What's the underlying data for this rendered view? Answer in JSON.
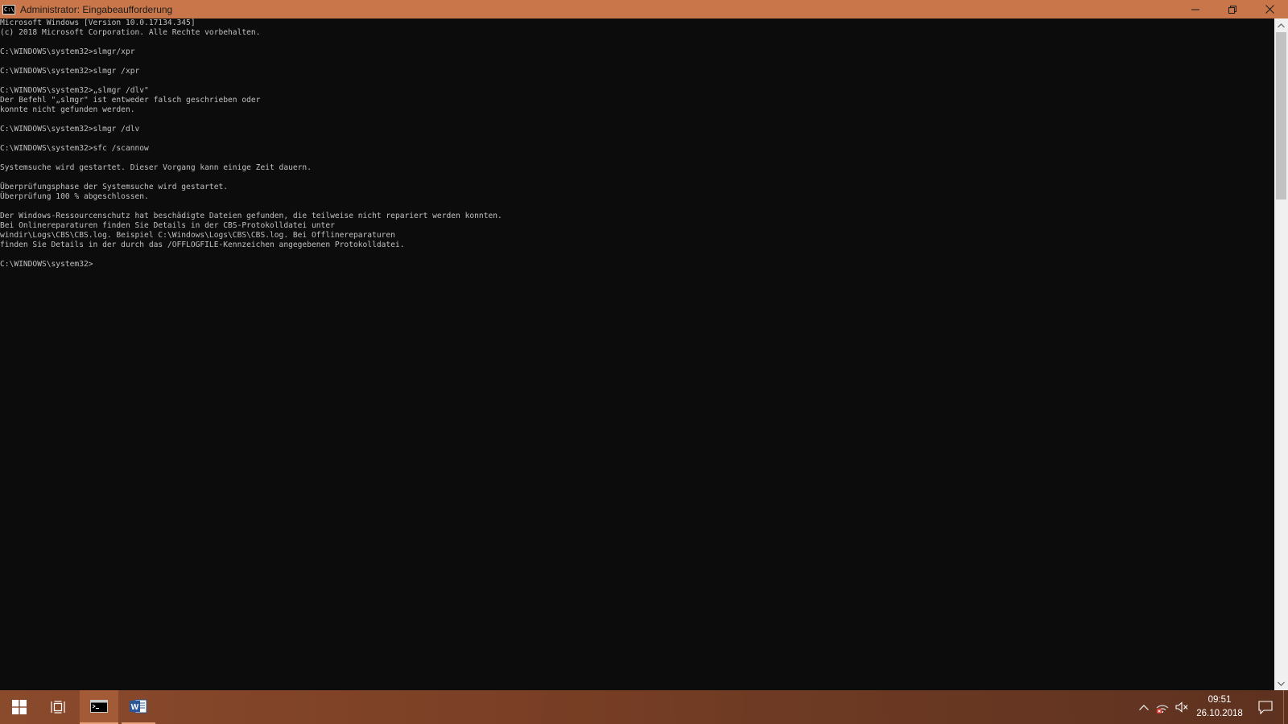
{
  "window": {
    "title": "Administrator: Eingabeaufforderung",
    "icon_text": "C:\\"
  },
  "console": {
    "lines": [
      "Microsoft Windows [Version 10.0.17134.345]",
      "(c) 2018 Microsoft Corporation. Alle Rechte vorbehalten.",
      "",
      "C:\\WINDOWS\\system32>slmgr/xpr",
      "",
      "C:\\WINDOWS\\system32>slmgr /xpr",
      "",
      "C:\\WINDOWS\\system32>„slmgr /dlv\"",
      "Der Befehl \"„slmgr\" ist entweder falsch geschrieben oder",
      "konnte nicht gefunden werden.",
      "",
      "C:\\WINDOWS\\system32>slmgr /dlv",
      "",
      "C:\\WINDOWS\\system32>sfc /scannow",
      "",
      "Systemsuche wird gestartet. Dieser Vorgang kann einige Zeit dauern.",
      "",
      "Überprüfungsphase der Systemsuche wird gestartet.",
      "Überprüfung 100 % abgeschlossen.",
      "",
      "Der Windows-Ressourcenschutz hat beschädigte Dateien gefunden, die teilweise nicht repariert werden konnten.",
      "Bei Onlinereparaturen finden Sie Details in der CBS-Protokolldatei unter",
      "windir\\Logs\\CBS\\CBS.log. Beispiel C:\\Windows\\Logs\\CBS\\CBS.log. Bei Offlinereparaturen",
      "finden Sie Details in der durch das /OFFLOGFILE-Kennzeichen angegebenen Protokolldatei.",
      "",
      "C:\\WINDOWS\\system32>"
    ]
  },
  "taskbar": {
    "apps": [
      {
        "name": "start",
        "icon": "windows-logo-icon"
      },
      {
        "name": "task-view",
        "icon": "task-view-icon"
      },
      {
        "name": "command-prompt",
        "icon": "cmd-icon",
        "active": true
      },
      {
        "name": "word",
        "icon": "word-icon",
        "open": true
      }
    ],
    "word_letter": "W",
    "clock": {
      "time": "09:51",
      "date": "26.10.2018"
    }
  },
  "colors": {
    "titlebar": "#c9774a",
    "console_bg": "#0c0c0c",
    "console_text": "#c0c0c0",
    "taskbar": "#7a3f25"
  }
}
